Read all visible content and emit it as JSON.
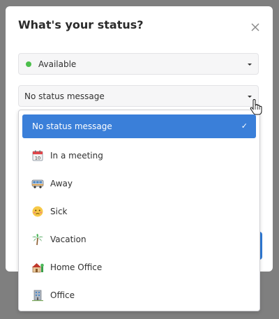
{
  "dialog": {
    "title": "What's your status?",
    "close_icon": "close-icon"
  },
  "status_select": {
    "value": "Available",
    "indicator_color": "#4cbf4c"
  },
  "message_select": {
    "value": "No status message"
  },
  "dropdown": {
    "selected_label": "No status message",
    "check_icon": "✓",
    "options": [
      {
        "label": "In a meeting",
        "icon": "calendar-icon"
      },
      {
        "label": "Away",
        "icon": "bus-icon"
      },
      {
        "label": "Sick",
        "icon": "sick-face-icon"
      },
      {
        "label": "Vacation",
        "icon": "palm-tree-icon"
      },
      {
        "label": "Home Office",
        "icon": "house-icon"
      },
      {
        "label": "Office",
        "icon": "office-building-icon"
      }
    ]
  },
  "colors": {
    "accent": "#3a7fd9",
    "available": "#4cbf4c",
    "backdrop": "#7f7f7f"
  }
}
